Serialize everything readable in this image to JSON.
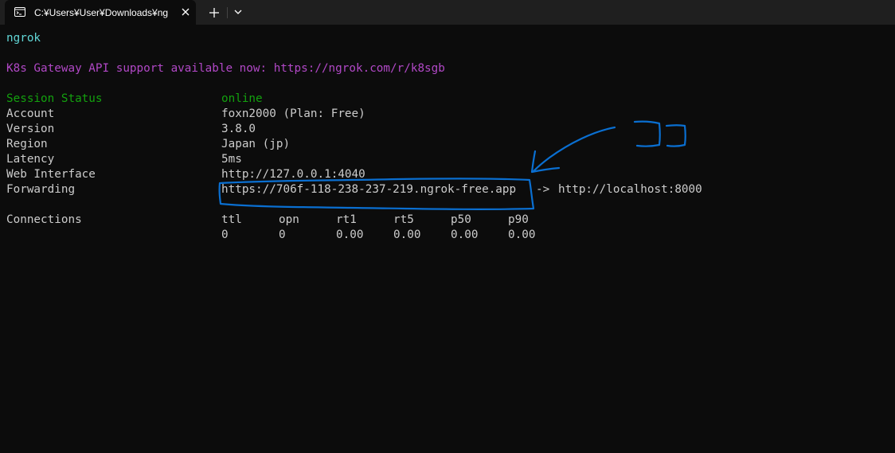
{
  "tab": {
    "title": "C:¥Users¥User¥Downloads¥ng",
    "close_icon": "close-icon",
    "new_tab_icon": "plus-icon",
    "dropdown_icon": "chevron-down-icon"
  },
  "terminal": {
    "app_name": "ngrok",
    "announcement": "K8s Gateway API support available now: https://ngrok.com/r/k8sgb",
    "session": [
      {
        "label": "Session Status",
        "value": "online"
      },
      {
        "label": "Account",
        "value": "foxn2000 (Plan: Free)"
      },
      {
        "label": "Version",
        "value": "3.8.0"
      },
      {
        "label": "Region",
        "value": "Japan (jp)"
      },
      {
        "label": "Latency",
        "value": "5ms"
      },
      {
        "label": "Web Interface",
        "value": "http://127.0.0.1:4040"
      }
    ],
    "forwarding": {
      "label": "Forwarding",
      "public_url": "https://706f-118-238-237-219.ngrok-free.app",
      "arrow": "->",
      "local_url": "http://localhost:8000"
    },
    "connections": {
      "label": "Connections",
      "headers": [
        "ttl",
        "opn",
        "rt1",
        "rt5",
        "p50",
        "p90"
      ],
      "values": [
        "0",
        "0",
        "0.00",
        "0.00",
        "0.00",
        "0.00"
      ]
    }
  },
  "annotation": {
    "text": "ココ",
    "color": "#0a6fd1"
  },
  "colors": {
    "background": "#0c0c0c",
    "tabbar": "#1f1f1f",
    "text": "#cccccc",
    "cyan": "#61d6d6",
    "magenta": "#b148c6",
    "green": "#13a10e"
  }
}
